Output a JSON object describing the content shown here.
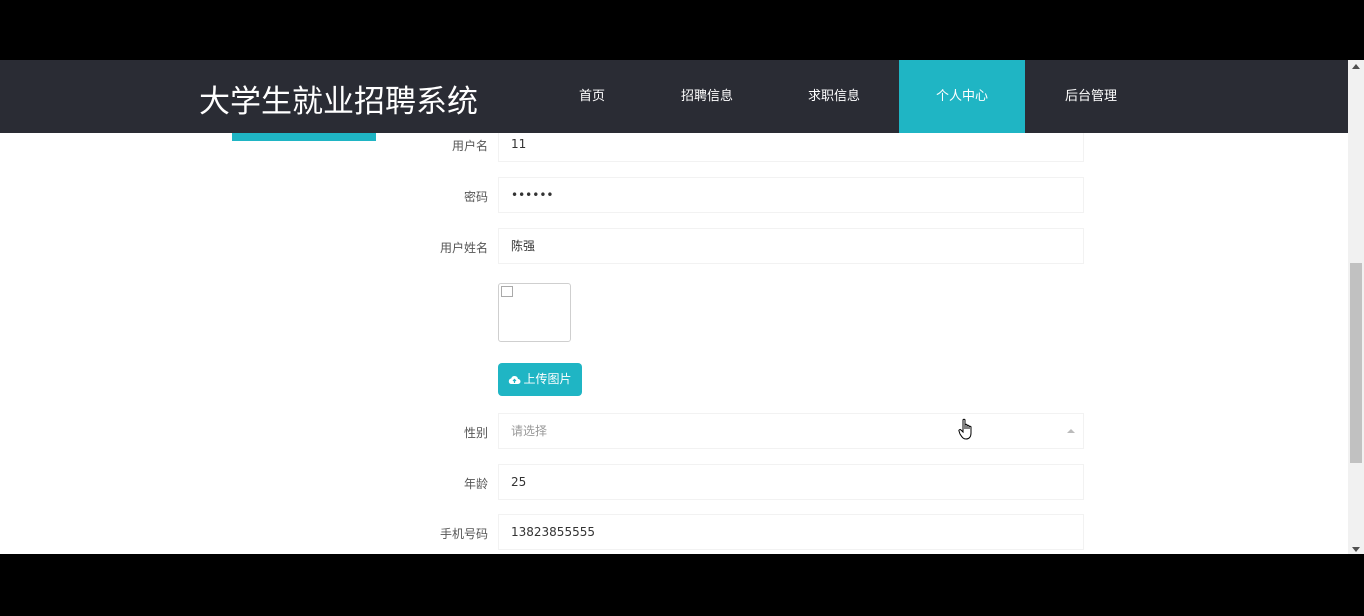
{
  "header": {
    "brand": "大学生就业招聘系统",
    "nav": [
      {
        "label": "首页",
        "active": false
      },
      {
        "label": "招聘信息",
        "active": false
      },
      {
        "label": "求职信息",
        "active": false
      },
      {
        "label": "个人中心",
        "active": true
      },
      {
        "label": "后台管理",
        "active": false
      }
    ],
    "accent_color": "#1fb5c4",
    "bg_color": "#2a2c34"
  },
  "form": {
    "username": {
      "label": "用户名",
      "value": "11"
    },
    "password": {
      "label": "密码",
      "value": "••••••"
    },
    "realname": {
      "label": "用户姓名",
      "value": "陈强"
    },
    "avatar": {
      "upload_label": "上传图片",
      "upload_icon": "cloud-upload-icon"
    },
    "gender": {
      "label": "性别",
      "placeholder": "请选择"
    },
    "age": {
      "label": "年龄",
      "value": "25"
    },
    "phone": {
      "label": "手机号码",
      "value": "13823855555"
    }
  }
}
